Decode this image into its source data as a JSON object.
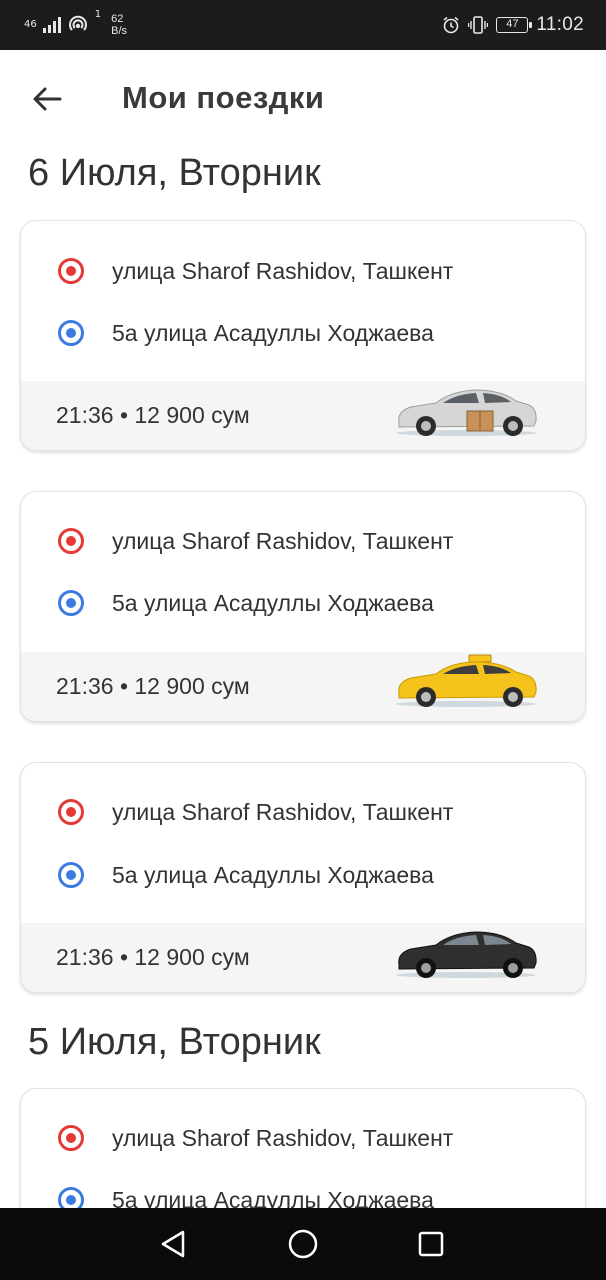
{
  "status_bar": {
    "network": "46",
    "signal_sub": "1",
    "speed_value": "62",
    "speed_unit": "B/s",
    "battery": "47",
    "time": "11:02"
  },
  "header": {
    "title": "Мои поездки",
    "back_icon": "arrow-left-icon"
  },
  "groups": [
    {
      "date": "6 Июля, Вторник",
      "trips": [
        {
          "from": "улица Sharof Rashidov, Ташкент",
          "to": "5а улица Асадуллы Ходжаева",
          "time": "21:36",
          "price": "12 900 сум",
          "info": "21:36 • 12 900 сум",
          "car": "silver-delivery-car",
          "car_color": "#d9d9d9"
        },
        {
          "from": "улица Sharof Rashidov, Ташкент",
          "to": "5а улица Асадуллы Ходжаева",
          "time": "21:36",
          "price": "12 900 сум",
          "info": "21:36 • 12 900 сум",
          "car": "yellow-taxi-car",
          "car_color": "#f6c21c"
        },
        {
          "from": "улица Sharof Rashidov, Ташкент",
          "to": "5а улица Асадуллы Ходжаева",
          "time": "21:36",
          "price": "12 900 сум",
          "info": "21:36 • 12 900 сум",
          "car": "black-car",
          "car_color": "#2f2f2f"
        }
      ]
    },
    {
      "date": "5 Июля, Вторник",
      "trips": [
        {
          "from": "улица Sharof Rashidov, Ташкент",
          "to": "5а улица Асадуллы Ходжаева"
        }
      ]
    }
  ],
  "colors": {
    "origin_marker": "#e53935",
    "destination_marker": "#3b7be0",
    "footer_bg": "#f5f5f5"
  },
  "nav_bar": {
    "back": "nav-back-icon",
    "home": "nav-home-icon",
    "recents": "nav-recents-icon"
  }
}
